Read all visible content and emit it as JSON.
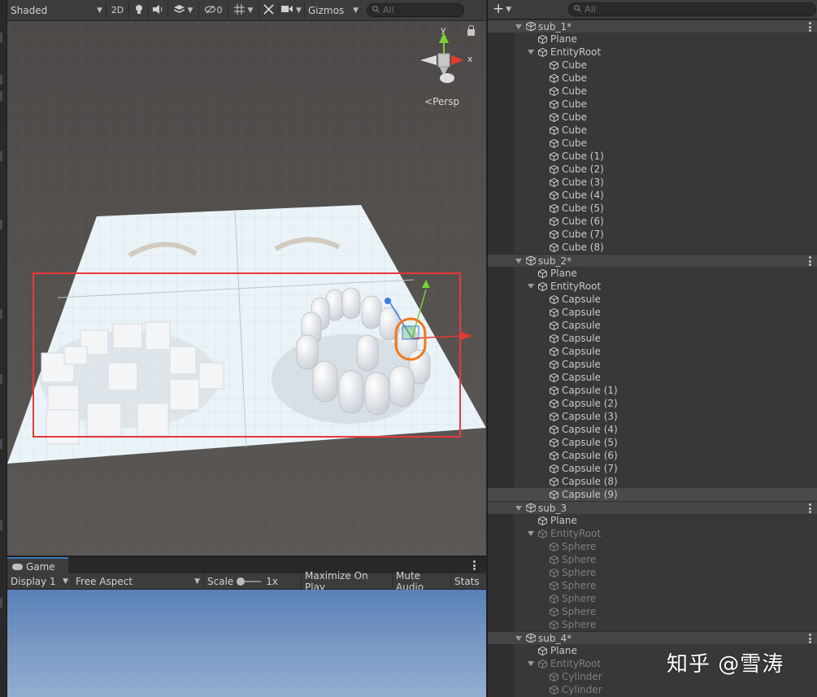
{
  "scene_toolbar": {
    "draw_mode": "Shaded",
    "btn_2d": "2D",
    "fx_count": "0",
    "gizmos": "Gizmos",
    "search_placeholder": "All"
  },
  "scene_view": {
    "projection": "Persp",
    "gizmo_axes": {
      "x": "x",
      "y": "y"
    }
  },
  "game_panel": {
    "tab_label": "Game",
    "display": "Display 1",
    "aspect": "Free Aspect",
    "scale_label": "Scale",
    "scale_value": "1x",
    "maximize": "Maximize On Play",
    "mute": "Mute Audio",
    "stats": "Stats"
  },
  "hierarchy": {
    "search_placeholder": "All",
    "scenes": [
      {
        "name": "sub_1*",
        "plane": "Plane",
        "root": "EntityRoot",
        "root_inactive": false,
        "children": [
          "Cube",
          "Cube",
          "Cube",
          "Cube",
          "Cube",
          "Cube",
          "Cube",
          "Cube (1)",
          "Cube (2)",
          "Cube (3)",
          "Cube (4)",
          "Cube (5)",
          "Cube (6)",
          "Cube (7)",
          "Cube (8)"
        ]
      },
      {
        "name": "sub_2*",
        "plane": "Plane",
        "root": "EntityRoot",
        "root_inactive": false,
        "children": [
          "Capsule",
          "Capsule",
          "Capsule",
          "Capsule",
          "Capsule",
          "Capsule",
          "Capsule",
          "Capsule (1)",
          "Capsule (2)",
          "Capsule (3)",
          "Capsule (4)",
          "Capsule (5)",
          "Capsule (6)",
          "Capsule (7)",
          "Capsule (8)",
          "Capsule (9)"
        ],
        "selected_child": "Capsule (9)"
      },
      {
        "name": "sub_3",
        "plane": "Plane",
        "root": "EntityRoot",
        "root_inactive": true,
        "children": [
          "Sphere",
          "Sphere",
          "Sphere",
          "Sphere",
          "Sphere",
          "Sphere",
          "Sphere"
        ]
      },
      {
        "name": "sub_4*",
        "plane": "Plane",
        "root": "EntityRoot",
        "root_inactive": true,
        "children": [
          "Cylinder",
          "Cylinder"
        ]
      }
    ]
  },
  "watermark": "知乎 @雪涛",
  "colors": {
    "highlight_box": "#e8393b",
    "selection_ring": "#f07a1a",
    "gizmo_x": "#e23b2e",
    "gizmo_y": "#7ccf33",
    "gizmo_z": "#3f7be0"
  }
}
